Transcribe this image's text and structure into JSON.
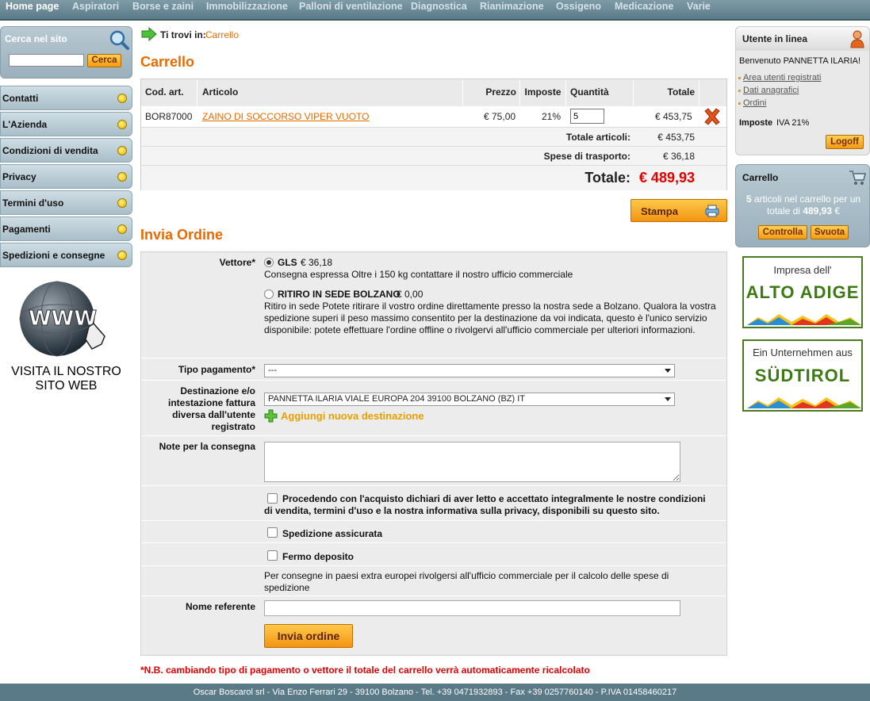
{
  "nav": [
    "Home page",
    "Aspiratori",
    "Borse e zaini",
    "Immobilizzazione",
    "Palloni di ventilazione",
    "Diagnostica",
    "Rianimazione",
    "Ossigeno",
    "Medicazione",
    "Varie"
  ],
  "search": {
    "title": "Cerca nel sito",
    "button": "Cerca",
    "value": ""
  },
  "sidebar": [
    "Contatti",
    "L'Azienda",
    "Condizioni di vendita",
    "Privacy",
    "Termini d'uso",
    "Pagamenti",
    "Spedizioni e consegne"
  ],
  "visita": {
    "line1": "VISITA IL NOSTRO",
    "line2": "SITO WEB"
  },
  "breadcrumb": {
    "label": "Ti trovi in:",
    "current": "Carrello"
  },
  "cart": {
    "title": "Carrello",
    "headers": {
      "code": "Cod. art.",
      "article": "Articolo",
      "price": "Prezzo",
      "tax": "Imposte",
      "qty": "Quantità",
      "total": "Totale"
    },
    "item": {
      "code": "BOR87000",
      "article": "ZAINO DI SOCCORSO VIPER VUOTO",
      "price": "€ 75,00",
      "tax": "21%",
      "qty": "5",
      "total": "€ 453,75"
    },
    "totale_articoli_label": "Totale articoli:",
    "totale_articoli": "€ 453,75",
    "spese_label": "Spese di trasporto:",
    "spese": "€ 36,18",
    "totale_label": "Totale:",
    "totale": "€ 489,93"
  },
  "stampa": "Stampa",
  "order": {
    "title": "Invia Ordine",
    "vettore_label": "Vettore*",
    "gls_name": "GLS",
    "gls_price": "€ 36,18",
    "gls_desc": "Consegna espressa Oltre i 150 kg contattare il nostro ufficio commerciale",
    "ritiro_name": "RITIRO IN SEDE BOLZANO",
    "ritiro_price": "€ 0,00",
    "ritiro_desc": "Ritiro in sede Potete ritirare il vostro ordine direttamente presso la nostra sede a Bolzano. Qualora la vostra spedizione superi il peso massimo consentito per la destinazione da voi indicata, questo è l'unico servizio disponibile: potete effettuare l'ordine offline o rivolgervi all'ufficio commerciale per ulteriori informazioni.",
    "pagamento_label": "Tipo pagamento*",
    "pagamento_value": "---",
    "destinazione_label": "Destinazione e/o intestazione fattura diversa dall'utente registrato",
    "destinazione_value": "PANNETTA ILARIA VIALE EUROPA 204 39100 BOLZANO (BZ) IT",
    "aggiungi": "Aggiungi nuova destinazione",
    "note_label": "Note per la consegna",
    "accetto": "Procedendo con l'acquisto dichiari di aver letto e accettato integralmente le nostre condizioni di vendita, termini d'uso e la nostra informativa sulla privacy, disponibili su questo sito.",
    "assicurata": "Spedizione assicurata",
    "fermo": "Fermo deposito",
    "extra_ue": "Per consegne in paesi extra europei rivolgersi all'ufficio commerciale per il calcolo delle spese di spedizione",
    "nome_label": "Nome referente",
    "submit": "Invia ordine"
  },
  "nb": "*N.B. cambiando tipo di pagamento o vettore il totale del carrello verrà automaticamente ricalcolato",
  "footer": "Oscar Boscarol srl - Via Enzo Ferrari 29 - 39100 Bolzano - Tel. +39 0471932893 - Fax +39 0257760140 - P.IVA 01458460217",
  "user": {
    "title": "Utente in linea",
    "welcome": "Benvenuto PANNETTA ILARIA!",
    "links": [
      "Area utenti registrati",
      "Dati anagrafici",
      "Ordini"
    ],
    "imposte_label": "Imposte",
    "imposte_value": "IVA 21%",
    "logoff": "Logoff"
  },
  "cartpanel": {
    "title": "Carrello",
    "count": "5",
    "text1": "articoli nel carrello per un totale di",
    "amount": "489,93",
    "currency": "€",
    "controlla": "Controlla",
    "svuota": "Svuota"
  },
  "badges": [
    {
      "top": "Impresa dell'",
      "big": "ALTO ADIGE"
    },
    {
      "top": "Ein Unternehmen aus",
      "big": "SÜDTIROL"
    }
  ],
  "colors": {
    "accent": "#e86a00",
    "nav": "#5b7a88",
    "total_red": "#e20000"
  }
}
